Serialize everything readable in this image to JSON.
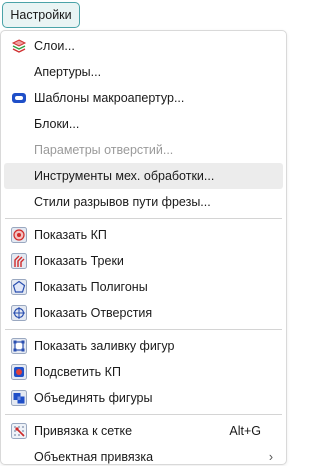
{
  "top_button": {
    "label": "Настройки"
  },
  "menu": {
    "items": [
      {
        "label": "Слои...",
        "icon": "layers-icon"
      },
      {
        "label": "Апертуры..."
      },
      {
        "label": "Шаблоны макроапертур...",
        "icon": "macro-aperture-icon"
      },
      {
        "label": "Блоки..."
      },
      {
        "label": "Параметры отверстий...",
        "disabled": true
      },
      {
        "label": "Инструменты мех. обработки...",
        "highlighted": true
      },
      {
        "label": "Стили разрывов пути фрезы..."
      },
      {
        "label": "Показать КП",
        "icon": "show-pads-icon"
      },
      {
        "label": "Показать Треки",
        "icon": "show-tracks-icon"
      },
      {
        "label": "Показать Полигоны",
        "icon": "show-polygons-icon"
      },
      {
        "label": "Показать Отверстия",
        "icon": "show-holes-icon"
      },
      {
        "label": "Показать заливку фигур",
        "icon": "fill-shapes-icon"
      },
      {
        "label": "Подсветить КП",
        "icon": "highlight-pads-icon"
      },
      {
        "label": "Объединять фигуры",
        "icon": "merge-shapes-icon"
      },
      {
        "label": "Привязка к сетке",
        "icon": "snap-grid-icon",
        "shortcut": "Alt+G"
      },
      {
        "label": "Объектная привязка",
        "submenu_arrow": "›"
      }
    ]
  }
}
